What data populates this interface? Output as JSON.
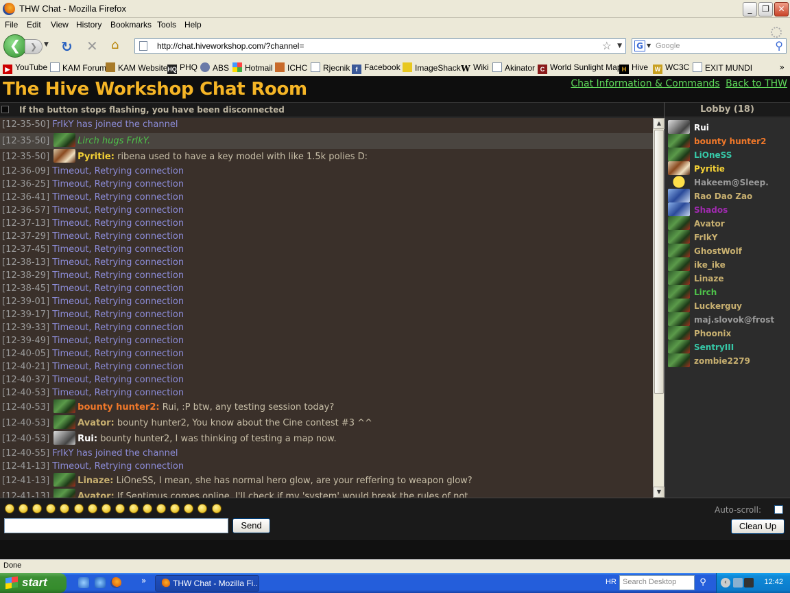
{
  "window": {
    "title": "THW Chat - Mozilla Firefox"
  },
  "menu": [
    "File",
    "Edit",
    "View",
    "History",
    "Bookmarks",
    "Tools",
    "Help"
  ],
  "nav": {
    "url": "http://chat.hiveworkshop.com/?channel=",
    "search_placeholder": "Google"
  },
  "bookmarks": [
    "YouTube",
    "KAM Forum",
    "KAM Website",
    "PHQ",
    "ABS",
    "Hotmail",
    "ICHC",
    "Rjecnik",
    "Facebook",
    "ImageShack",
    "Wiki",
    "Akinator",
    "World Sunlight Map",
    "Hive",
    "WC3C",
    "EXIT MUNDI"
  ],
  "header": {
    "title": "The Hive Workshop Chat Room",
    "link_info": "Chat Information & Commands",
    "link_back": "Back to THW"
  },
  "notice": "If the button stops flashing, you have been disconnected",
  "lobby": "Lobby (18)",
  "colors": {
    "accent": "#f5b526",
    "link": "#5fd85a",
    "system": "#8c8cd8"
  },
  "messages": [
    {
      "ts": "[12-35-50]",
      "type": "sys",
      "text": "FrIkY has joined the channel"
    },
    {
      "ts": "[12-35-50]",
      "type": "action",
      "user": "Lirch",
      "color": "#4ec24a",
      "text": "Lirch hugs FrIkY.",
      "av": "orc"
    },
    {
      "ts": "[12-35-50]",
      "type": "chat",
      "user": "Pyritie:",
      "color": "#f5d236",
      "text": "ribena used to have a key model with like 1.5k polies D:",
      "av": "eagle"
    },
    {
      "ts": "[12-36-09]",
      "type": "sys",
      "text": "Timeout, Retrying connection"
    },
    {
      "ts": "[12-36-25]",
      "type": "sys",
      "text": "Timeout, Retrying connection"
    },
    {
      "ts": "[12-36-41]",
      "type": "sys",
      "text": "Timeout, Retrying connection"
    },
    {
      "ts": "[12-36-57]",
      "type": "sys",
      "text": "Timeout, Retrying connection"
    },
    {
      "ts": "[12-37-13]",
      "type": "sys",
      "text": "Timeout, Retrying connection"
    },
    {
      "ts": "[12-37-29]",
      "type": "sys",
      "text": "Timeout, Retrying connection"
    },
    {
      "ts": "[12-37-45]",
      "type": "sys",
      "text": "Timeout, Retrying connection"
    },
    {
      "ts": "[12-38-13]",
      "type": "sys",
      "text": "Timeout, Retrying connection"
    },
    {
      "ts": "[12-38-29]",
      "type": "sys",
      "text": "Timeout, Retrying connection"
    },
    {
      "ts": "[12-38-45]",
      "type": "sys",
      "text": "Timeout, Retrying connection"
    },
    {
      "ts": "[12-39-01]",
      "type": "sys",
      "text": "Timeout, Retrying connection"
    },
    {
      "ts": "[12-39-17]",
      "type": "sys",
      "text": "Timeout, Retrying connection"
    },
    {
      "ts": "[12-39-33]",
      "type": "sys",
      "text": "Timeout, Retrying connection"
    },
    {
      "ts": "[12-39-49]",
      "type": "sys",
      "text": "Timeout, Retrying connection"
    },
    {
      "ts": "[12-40-05]",
      "type": "sys",
      "text": "Timeout, Retrying connection"
    },
    {
      "ts": "[12-40-21]",
      "type": "sys",
      "text": "Timeout, Retrying connection"
    },
    {
      "ts": "[12-40-37]",
      "type": "sys",
      "text": "Timeout, Retrying connection"
    },
    {
      "ts": "[12-40-53]",
      "type": "sys",
      "text": "Timeout, Retrying connection"
    },
    {
      "ts": "[12-40-53]",
      "type": "chat",
      "user": "bounty hunter2:",
      "color": "#f0782a",
      "text": "Rui, :P btw, any testing session today?",
      "av": "orc"
    },
    {
      "ts": "[12-40-53]",
      "type": "chat",
      "user": "Avator:",
      "color": "#c8b070",
      "text": "bounty hunter2, You know about the Cine contest #3 ^^",
      "av": "orc"
    },
    {
      "ts": "[12-40-53]",
      "type": "chat",
      "user": "Rui:",
      "color": "#ffffff",
      "text": "bounty hunter2, I was thinking of testing a map now.",
      "av": "bone"
    },
    {
      "ts": "[12-40-55]",
      "type": "sys",
      "text": "FrIkY has joined the channel"
    },
    {
      "ts": "[12-41-13]",
      "type": "sys",
      "text": "Timeout, Retrying connection"
    },
    {
      "ts": "[12-41-13]",
      "type": "chat",
      "user": "Linaze:",
      "color": "#c8b070",
      "text": "LiOneSS, I mean, she has normal hero glow, are your reffering to weapon glow?",
      "av": "orc"
    },
    {
      "ts": "[12-41-13]",
      "type": "chat",
      "user": "Avator:",
      "color": "#c8b070",
      "text": "If Septimus comes online, I'll check if my 'system' would break the rules of not",
      "av": "orc"
    }
  ],
  "users": [
    {
      "name": "Rui",
      "color": "#ffffff",
      "av": "bone"
    },
    {
      "name": "bounty hunter2",
      "color": "#f0782a",
      "av": "orc"
    },
    {
      "name": "LiOneSS",
      "color": "#36c8a8",
      "av": "orc"
    },
    {
      "name": "Pyritie",
      "color": "#f5d236",
      "av": "eagle"
    },
    {
      "name": "Hakeem@Sleep.",
      "color": "#9a9a9a",
      "av": "smile"
    },
    {
      "name": "Rao Dao Zao",
      "color": "#c8b070",
      "av": "blue"
    },
    {
      "name": "Shados",
      "color": "#a02ab0",
      "av": "blue"
    },
    {
      "name": "Avator",
      "color": "#c8b070",
      "av": "orc"
    },
    {
      "name": "FrIkY",
      "color": "#c8b070",
      "av": "orc"
    },
    {
      "name": "GhostWolf",
      "color": "#c8b070",
      "av": "orc"
    },
    {
      "name": "ike_ike",
      "color": "#c8b070",
      "av": "orc"
    },
    {
      "name": "Linaze",
      "color": "#c8b070",
      "av": "orc"
    },
    {
      "name": "Lirch",
      "color": "#4ec24a",
      "av": "orc"
    },
    {
      "name": "Luckerguy",
      "color": "#c8b070",
      "av": "orc"
    },
    {
      "name": "maj.slovok@frost",
      "color": "#9a9a9a",
      "av": "orc"
    },
    {
      "name": "Phoonix",
      "color": "#c8b070",
      "av": "orc"
    },
    {
      "name": "SentryIII",
      "color": "#36c8a8",
      "av": "orc"
    },
    {
      "name": "zombie2279",
      "color": "#c8b070",
      "av": "orc"
    }
  ],
  "smileys": [
    "smile",
    "unsure",
    "cool",
    "confused",
    "grin",
    "sad",
    "happy",
    "surprised",
    "wink",
    "hmm",
    "alert",
    "eek",
    "laugh",
    "tongue",
    "blush",
    "glasses"
  ],
  "input": {
    "value": "",
    "send_label": "Send",
    "autoscroll_label": "Auto-scroll:",
    "cleanup_label": "Clean Up"
  },
  "status": "Done",
  "taskbar": {
    "start": "start",
    "task": "THW Chat - Mozilla Fi...",
    "lang": "HR",
    "desktop_search": "Search Desktop",
    "clock": "12:42"
  }
}
